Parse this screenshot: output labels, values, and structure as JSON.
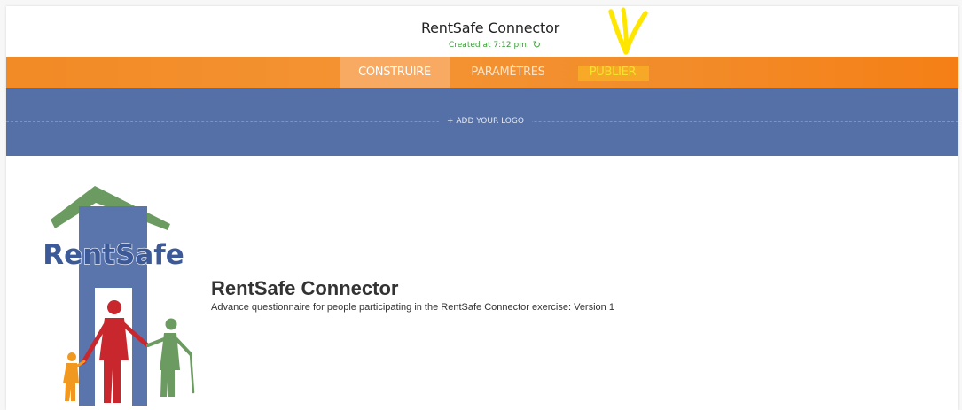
{
  "header": {
    "title": "RentSafe Connector",
    "status": "Created at 7:12 pm.",
    "refresh_icon": "refresh-icon"
  },
  "nav": {
    "tabs": [
      {
        "label": "CONSTRUIRE",
        "active": true
      },
      {
        "label": "PARAMÈTRES",
        "active": false
      },
      {
        "label": "PUBLIER",
        "active": false
      }
    ]
  },
  "logo_band": {
    "add_logo_label": "+ ADD YOUR LOGO"
  },
  "survey": {
    "logo_text": "RentSafe",
    "title": "RentSafe Connector",
    "description": "Advance questionnaire for people participating in the RentSafe Connector exercise: Version 1"
  },
  "colors": {
    "nav_orange": "#f28a25",
    "active_tab": "#f8aa62",
    "publier_yellow": "#f3e33a",
    "logo_band_blue": "#5570a6",
    "status_green": "#3e9b3b",
    "annotation_yellow": "#ffe600"
  }
}
